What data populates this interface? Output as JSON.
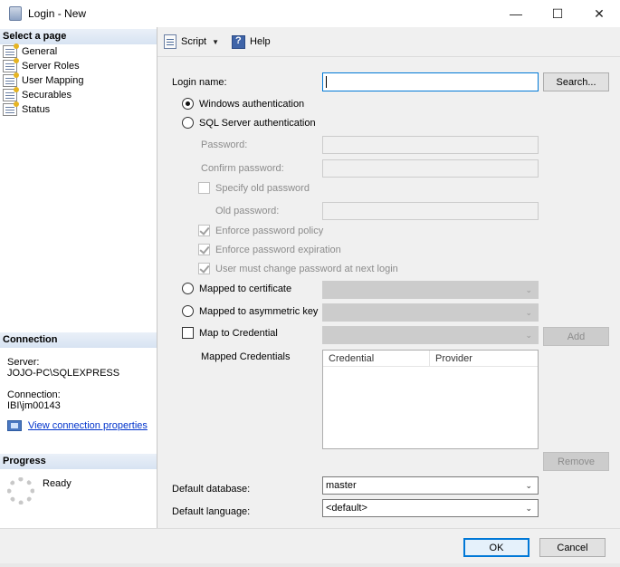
{
  "window": {
    "title": "Login - New",
    "minimize": "—",
    "maximize": "☐",
    "close": "✕"
  },
  "left": {
    "select_page_header": "Select a page",
    "pages": [
      "General",
      "Server Roles",
      "User Mapping",
      "Securables",
      "Status"
    ],
    "connection_header": "Connection",
    "server_label": "Server:",
    "server_value": "JOJO-PC\\SQLEXPRESS",
    "connection_label": "Connection:",
    "connection_value": "IBI\\jm00143",
    "view_props_link": "View connection properties",
    "progress_header": "Progress",
    "progress_status": "Ready"
  },
  "toolbar": {
    "script_label": "Script",
    "help_label": "Help"
  },
  "form": {
    "login_name_label": "Login name:",
    "login_name_value": "",
    "search_button": "Search...",
    "windows_auth": "Windows authentication",
    "sql_auth": "SQL Server authentication",
    "password_label": "Password:",
    "confirm_password_label": "Confirm password:",
    "specify_old_password": "Specify old password",
    "old_password_label": "Old password:",
    "enforce_policy": "Enforce password policy",
    "enforce_expiration": "Enforce password expiration",
    "must_change": "User must change password at next login",
    "mapped_certificate": "Mapped to certificate",
    "mapped_asym_key": "Mapped to asymmetric key",
    "map_credential": "Map to Credential",
    "add_button": "Add",
    "mapped_credentials_label": "Mapped Credentials",
    "grid_columns": [
      "Credential",
      "Provider"
    ],
    "remove_button": "Remove",
    "default_database_label": "Default database:",
    "default_database_value": "master",
    "default_language_label": "Default language:",
    "default_language_value": "<default>"
  },
  "footer": {
    "ok_button": "OK",
    "cancel_button": "Cancel"
  },
  "colors": {
    "accent": "#0078d7",
    "link": "#0033cc",
    "section_header_bg": "#d7e3f2"
  }
}
